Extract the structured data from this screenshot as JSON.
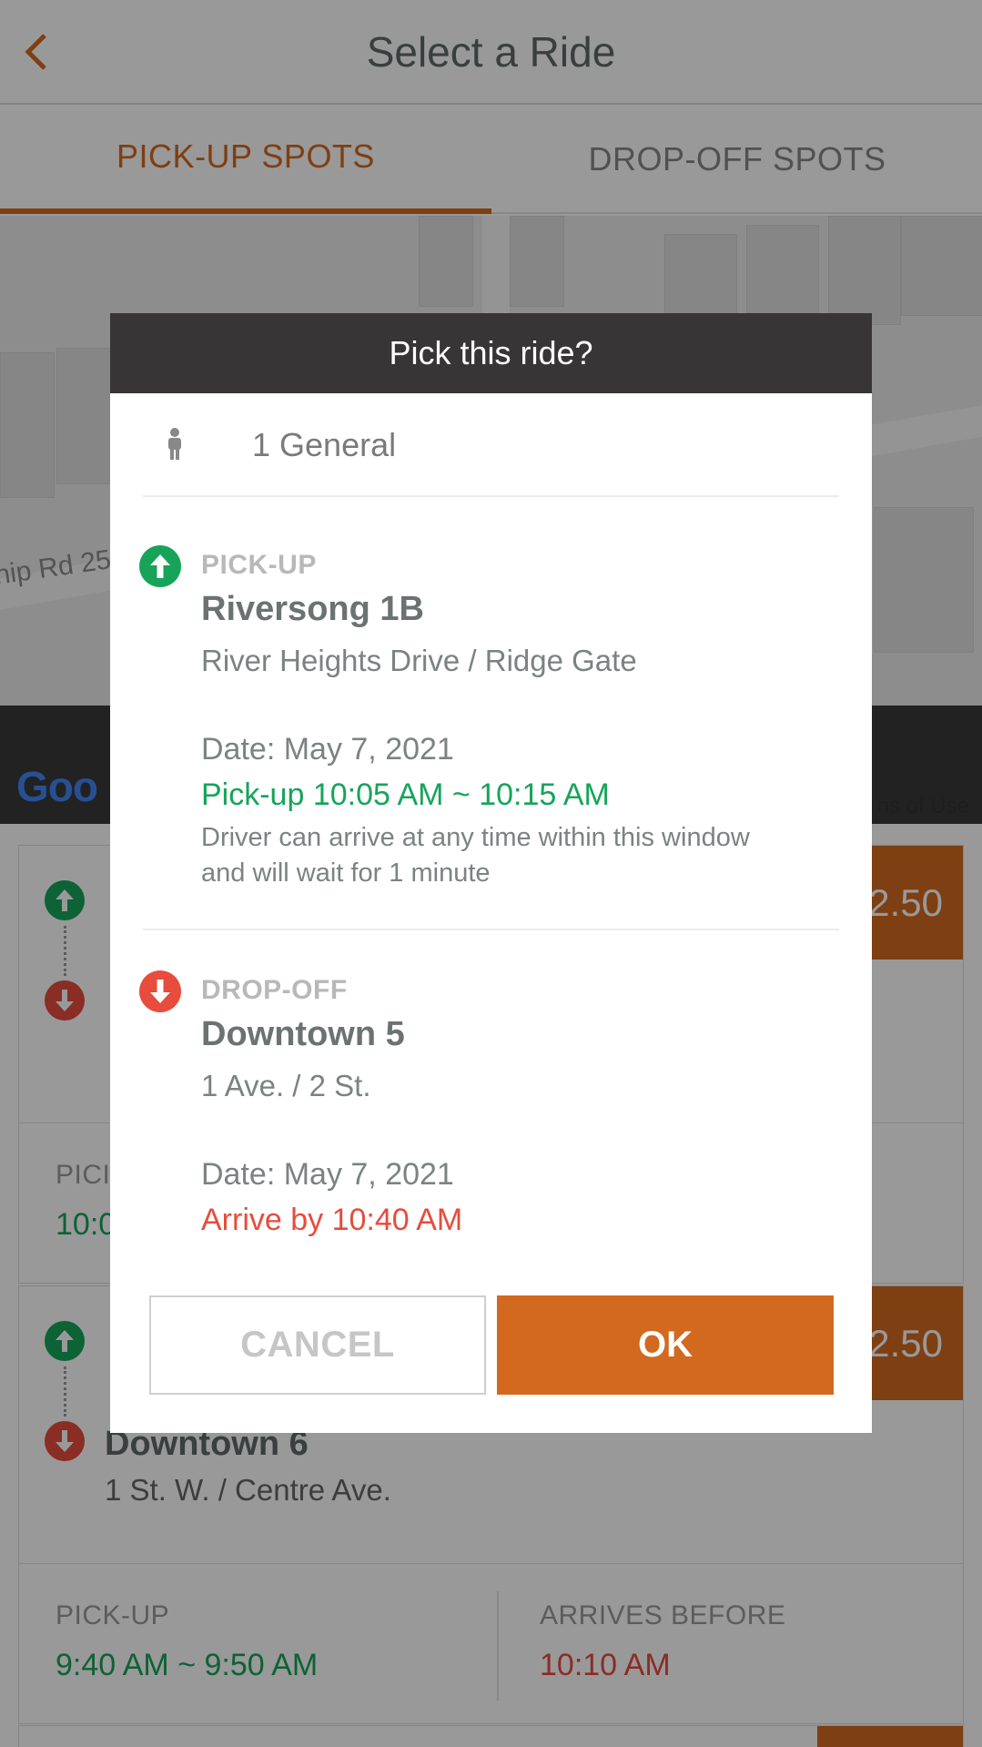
{
  "header": {
    "title": "Select a Ride",
    "back_icon": "chevron-left-icon"
  },
  "tabs": [
    {
      "label": "PICK-UP SPOTS",
      "active": true
    },
    {
      "label": "DROP-OFF SPOTS",
      "active": false
    }
  ],
  "map": {
    "road_label": "hip Rd 25",
    "google_logo": "Goo",
    "terms_label": "ns of Use"
  },
  "cards": [
    {
      "price": "2.50",
      "pickup_name": "",
      "pickup_addr": "",
      "dropoff_name": "",
      "dropoff_addr": "",
      "pickup_label": "PICI",
      "pickup_time": "10:0",
      "arrive_label": "",
      "arrive_time": ""
    },
    {
      "price": "2.50",
      "pickup_name": "",
      "pickup_addr": "",
      "dropoff_name": "Downtown 6",
      "dropoff_addr": "1 St. W. / Centre Ave.",
      "pickup_label": "PICK-UP",
      "pickup_time": "9:40 AM ~ 9:50 AM",
      "arrive_label": "ARRIVES BEFORE",
      "arrive_time": "10:10 AM"
    }
  ],
  "dialog": {
    "title": "Pick this ride?",
    "passenger": {
      "icon": "person-icon",
      "text": "1 General"
    },
    "pickup": {
      "label": "PICK-UP",
      "name": "Riversong 1B",
      "address": "River Heights Drive / Ridge Gate",
      "date": "Date: May 7, 2021",
      "window": "Pick-up 10:05 AM ~ 10:15 AM",
      "note": "Driver can arrive at any time within this window and will wait for 1 minute"
    },
    "dropoff": {
      "label": "DROP-OFF",
      "name": "Downtown 5",
      "address": "1 Ave. / 2 St.",
      "date": "Date: May 7, 2021",
      "arrive": "Arrive by 10:40 AM"
    },
    "cancel_label": "CANCEL",
    "ok_label": "OK"
  },
  "colors": {
    "accent": "#d2691e",
    "pickup_green": "#17a45a",
    "dropoff_red": "#e74c3c",
    "dialog_header": "#373536"
  }
}
